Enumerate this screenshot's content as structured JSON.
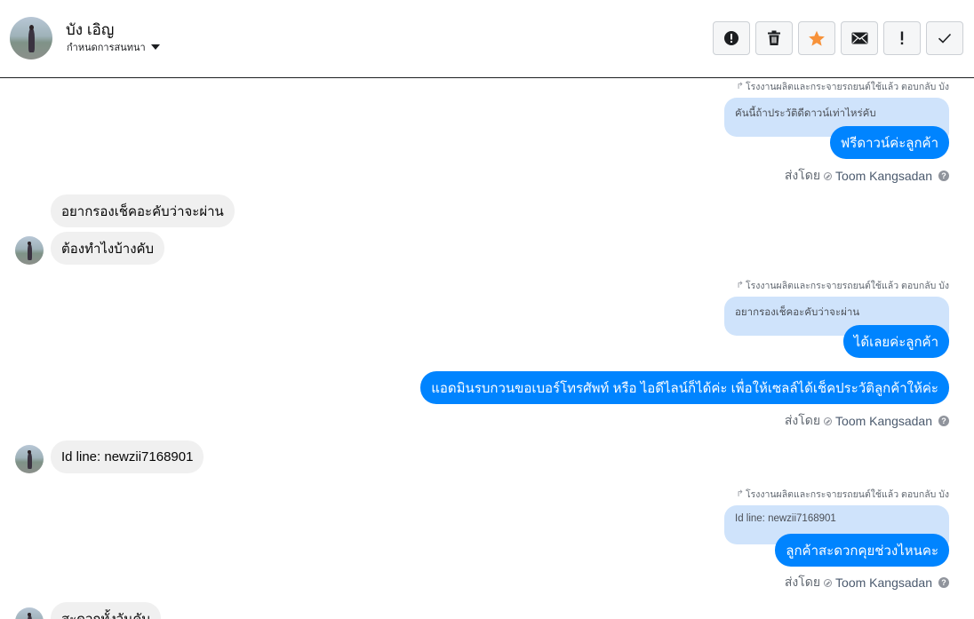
{
  "header": {
    "name": "บัง เอิญ",
    "subtitle": "กำหนดการสนทนา"
  },
  "toolbar": {
    "buttons": [
      "spam-icon",
      "trash-icon",
      "star-icon",
      "mail-icon",
      "mark-important-icon",
      "checkmark-icon"
    ],
    "accent_star": "#f7923a"
  },
  "messages": {
    "reply_note": "โรงงานผลิตและกระจายรถยนต์ใช้แล้ว ตอบกลับ บัง",
    "sent_by_prefix": "ส่งโดย",
    "agent_name": "Toom Kangsadan",
    "thread": [
      {
        "type": "out_quote",
        "quote": "คันนี้ถ้าประวัติดีดาวน์เท่าไหร่คับ",
        "text": "ฟรีดาวน์ค่ะลูกค้า"
      },
      {
        "type": "in",
        "text": "อยากรองเช็คอะคับว่าจะผ่าน"
      },
      {
        "type": "in",
        "text": "ต้องทำไงบ้างคับ"
      },
      {
        "type": "out_quote",
        "quote": "อยากรองเช็คอะคับว่าจะผ่าน",
        "text": "ได้เลยค่ะลูกค้า"
      },
      {
        "type": "out",
        "text": "แอดมินรบกวนขอเบอร์โทรศัพท์ หรือ ไอดีไลน์ก็ได้ค่ะ เพื่อให้เซลล์ได้เช็คประวัติลูกค้าให้ค่ะ"
      },
      {
        "type": "in",
        "text": "Id line: newzii7168901"
      },
      {
        "type": "out_quote",
        "quote": "Id line: newzii7168901",
        "text": "ลูกค้าสะดวกคุยช่วงไหนคะ"
      },
      {
        "type": "in",
        "text": "สะดวกทั้งวันคับ"
      }
    ]
  },
  "colors": {
    "outgoing_bubble": "#0084ff",
    "quote_bubble": "#cfe3fb",
    "incoming_bubble": "#f0f0f0"
  }
}
